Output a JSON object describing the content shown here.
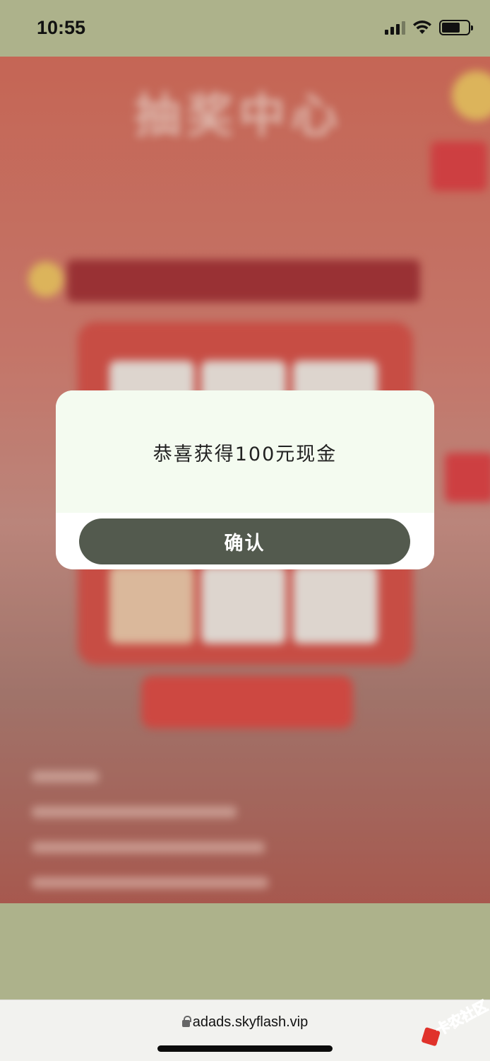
{
  "status_bar": {
    "time": "10:55",
    "icons": [
      "cellular-signal-icon",
      "wifi-icon",
      "battery-icon"
    ]
  },
  "background_page": {
    "title": "抽奖中心",
    "blurred": true
  },
  "dialog": {
    "message": "恭喜获得100元现金",
    "confirm_label": "确认"
  },
  "browser": {
    "url": "adads.skyflash.vip",
    "secure_icon": "lock-icon"
  },
  "watermark": {
    "text": "卡农社区"
  },
  "colors": {
    "chrome_background": "#adb28b",
    "dialog_body": "#f4fbf0",
    "confirm_button": "#535a4e",
    "page_accent": "#d8463e"
  }
}
